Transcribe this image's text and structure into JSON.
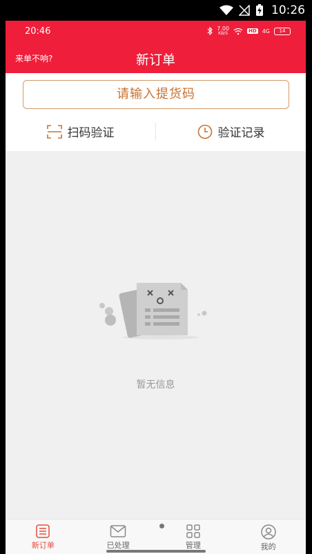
{
  "system": {
    "time": "10:26"
  },
  "inner_status": {
    "time": "20:46",
    "speed": "7.00",
    "speed_unit": "KB/S",
    "hd": "HD",
    "network": "4G",
    "battery": "14"
  },
  "header": {
    "help_link": "来单不响?",
    "title": "新订单"
  },
  "pickup": {
    "placeholder": "请输入提货码"
  },
  "actions": {
    "scan": "扫码验证",
    "records": "验证记录"
  },
  "empty": {
    "text": "暂无信息"
  },
  "tabs": [
    {
      "label": "新订单",
      "icon": "list-icon",
      "active": true
    },
    {
      "label": "已处理",
      "icon": "mail-icon",
      "active": false
    },
    {
      "label": "管理",
      "icon": "grid-icon",
      "active": false
    },
    {
      "label": "我的",
      "icon": "user-icon",
      "active": false
    }
  ],
  "colors": {
    "brand_red": "#ef1e3a",
    "accent_orange": "#c9712f",
    "tab_active": "#e84a3b"
  }
}
